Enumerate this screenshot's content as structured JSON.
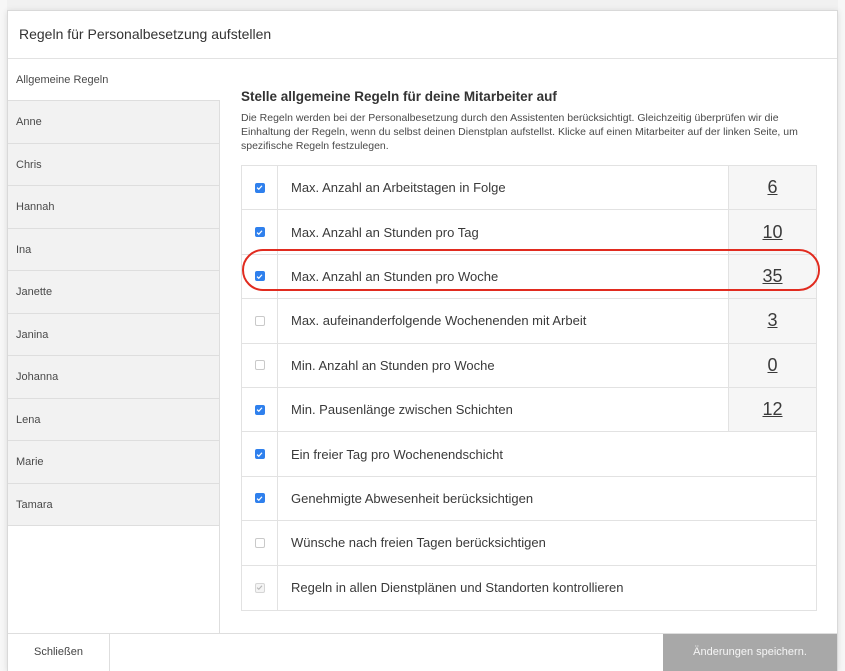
{
  "modal": {
    "title": "Regeln für Personalbesetzung aufstellen"
  },
  "sidebar": {
    "items": [
      {
        "label": "Allgemeine Regeln",
        "active": true
      },
      {
        "label": "Anne"
      },
      {
        "label": "Chris"
      },
      {
        "label": "Hannah"
      },
      {
        "label": "Ina"
      },
      {
        "label": "Janette"
      },
      {
        "label": "Janina"
      },
      {
        "label": "Johanna"
      },
      {
        "label": "Lena"
      },
      {
        "label": "Marie"
      },
      {
        "label": "Tamara"
      }
    ]
  },
  "main": {
    "title": "Stelle allgemeine Regeln für deine Mitarbeiter auf",
    "description": "Die Regeln werden bei der Personalbesetzung durch den Assistenten berücksichtigt. Gleichzeitig überprüfen wir die Einhaltung der Regeln, wenn du selbst deinen Dienstplan aufstellst. Klicke auf einen Mitarbeiter auf der linken Seite, um spezifische Regeln festzulegen.",
    "rules": [
      {
        "label": "Max. Anzahl an Arbeitstagen in Folge",
        "checked": true,
        "value": "6"
      },
      {
        "label": "Max. Anzahl an Stunden pro Tag",
        "checked": true,
        "value": "10"
      },
      {
        "label": "Max. Anzahl an Stunden pro Woche",
        "checked": true,
        "value": "35"
      },
      {
        "label": "Max. aufeinanderfolgende Wochenenden mit Arbeit",
        "checked": false,
        "value": "3"
      },
      {
        "label": "Min. Anzahl an Stunden pro Woche",
        "checked": false,
        "value": "0"
      },
      {
        "label": "Min. Pausenlänge zwischen Schichten",
        "checked": true,
        "value": "12"
      },
      {
        "label": "Ein freier Tag pro Wochenendschicht",
        "checked": true
      },
      {
        "label": "Genehmigte Abwesenheit berücksichtigen",
        "checked": true
      },
      {
        "label": "Wünsche nach freien Tagen berücksichtigen",
        "checked": false
      },
      {
        "label": "Regeln in allen Dienstplänen und Standorten kontrollieren",
        "checked": true,
        "disabled": true
      }
    ]
  },
  "footer": {
    "close_label": "Schließen",
    "save_label": "Änderungen speichern."
  },
  "colors": {
    "checkbox_on": "#2f80ed",
    "highlight": "#e12b1f",
    "save_button": "#a8a8a8"
  }
}
